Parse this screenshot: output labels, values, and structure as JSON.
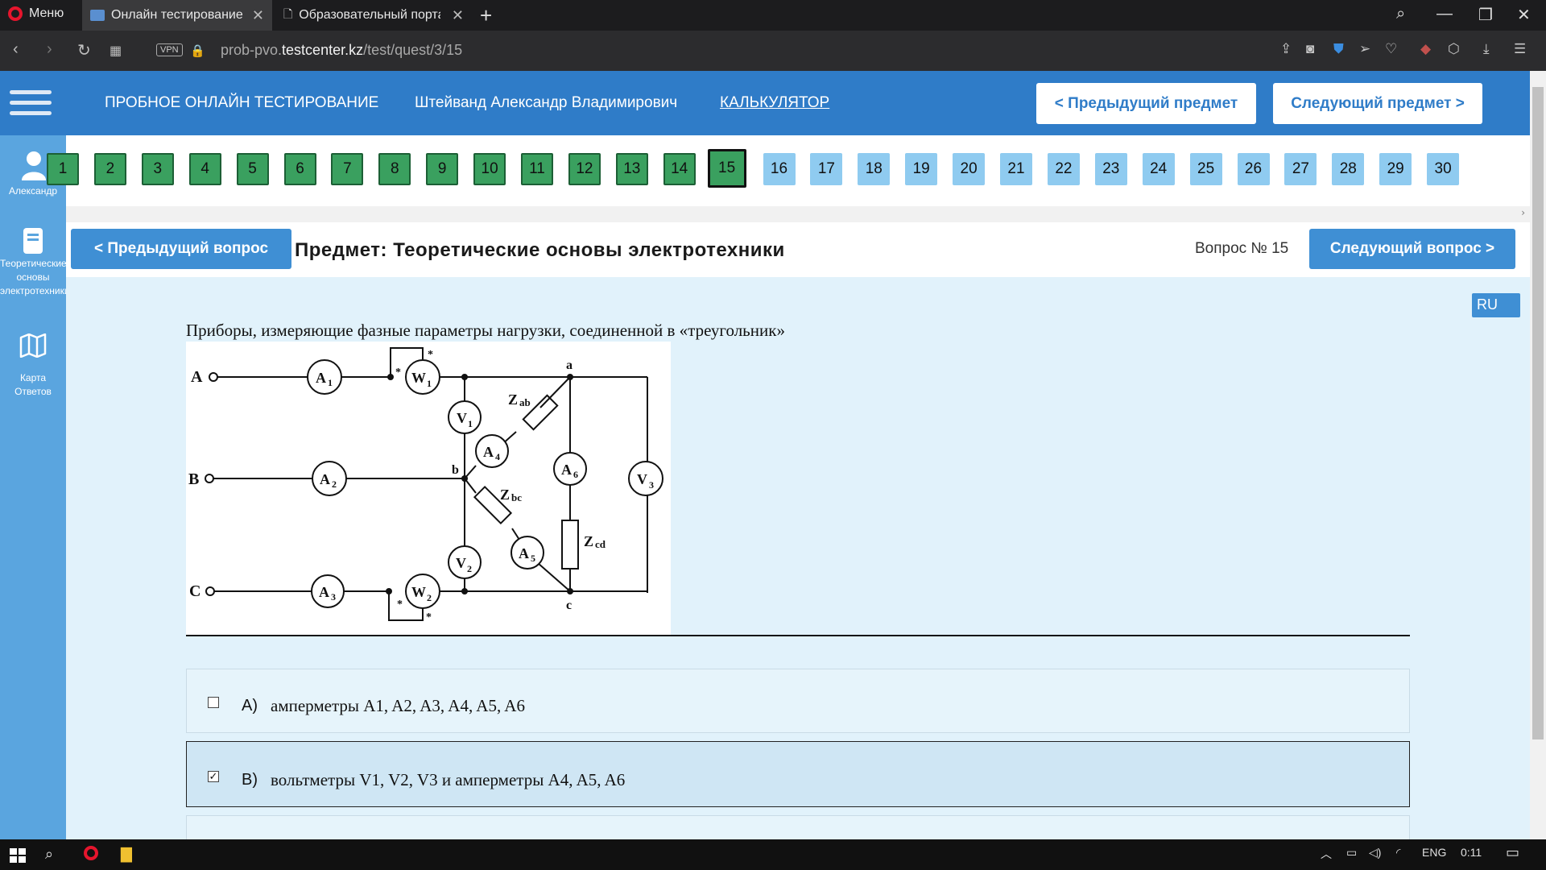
{
  "browser": {
    "menu_label": "Меню",
    "tabs": [
      {
        "title": "Онлайн тестирование",
        "active": true
      },
      {
        "title": "Образовательный портал",
        "active": false
      }
    ],
    "vpn": "VPN",
    "url_prefix": "prob-pvo.",
    "url_domain": "testcenter.kz",
    "url_path": "/test/quest/3/15"
  },
  "header": {
    "title": "ПРОБНОЕ ОНЛАЙН ТЕСТИРОВАНИЕ",
    "user_name": "Штейванд Александр Владимирович",
    "calculator": "КАЛЬКУЛЯТОР",
    "prev_subject": "< Предыдущий предмет",
    "next_subject": "Следующий предмет >"
  },
  "sidebar": {
    "user": "Александр",
    "subject_line1": "Теоретические",
    "subject_line2": "основы",
    "subject_line3": "электротехники",
    "map_line1": "Карта",
    "map_line2": "Ответов"
  },
  "questions": {
    "numbers": [
      "1",
      "2",
      "3",
      "4",
      "5",
      "6",
      "7",
      "8",
      "9",
      "10",
      "11",
      "12",
      "13",
      "14",
      "15",
      "16",
      "17",
      "18",
      "19",
      "20",
      "21",
      "22",
      "23",
      "24",
      "25",
      "26",
      "27",
      "28",
      "29",
      "30"
    ],
    "answered_count": 14,
    "current": 15
  },
  "qbar": {
    "prev": "< Предыдущий вопрос",
    "subject": "Предмет: Теоретические основы электротехники",
    "question_no": "Вопрос № 15",
    "next": "Следующий вопрос >"
  },
  "lang": "RU",
  "question": {
    "text": "Приборы, измеряющие фазные параметры нагрузки, соединенной в «треугольник»",
    "circuit_labels": {
      "A": "A",
      "B": "B",
      "C": "C",
      "a": "a",
      "b": "b",
      "c": "c",
      "A1": "A",
      "A2": "A",
      "A3": "A",
      "A4": "A",
      "A5": "A",
      "A6": "A",
      "W1": "W",
      "W2": "W",
      "V1": "V",
      "V2": "V",
      "V3": "V",
      "Zab": "Z",
      "Zbc": "Z",
      "Zcd": "Z"
    }
  },
  "answers": [
    {
      "letter": "A)",
      "text": "амперметры A1, A2, A3, A4, A5, A6",
      "checked": false
    },
    {
      "letter": "B)",
      "text": "вольтметры V1, V2, V3 и амперметры A4, A5, A6",
      "checked": true
    }
  ],
  "taskbar": {
    "lang": "ENG",
    "time": "0:11"
  }
}
